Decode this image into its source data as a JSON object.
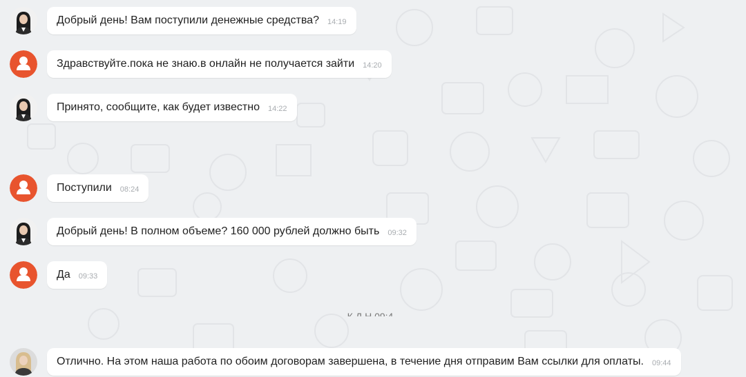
{
  "messages": [
    {
      "sender": "agent",
      "avatar_icon": "woman-photo-avatar-icon",
      "text": "Добрый день! Вам поступили денежные средства?",
      "time": "14:19"
    },
    {
      "sender": "client",
      "avatar_icon": "user-silhouette-avatar-icon",
      "text": "Здравствуйте.пока не знаю.в онлайн не получается зайти",
      "time": "14:20"
    },
    {
      "sender": "agent",
      "avatar_icon": "woman-photo-avatar-icon",
      "text": "Принято, сообщите, как будет известно",
      "time": "14:22"
    },
    {
      "sender": "client",
      "avatar_icon": "user-silhouette-avatar-icon",
      "text": "Поступили",
      "time": "08:24"
    },
    {
      "sender": "agent",
      "avatar_icon": "woman-photo-avatar-icon",
      "text": "Добрый день! В полном объеме? 160 000 рублей должно быть",
      "time": "09:32"
    },
    {
      "sender": "client",
      "avatar_icon": "user-silhouette-avatar-icon",
      "text": "Да",
      "time": "09:33"
    },
    {
      "sender": "agent2",
      "avatar_icon": "blonde-woman-photo-avatar-icon",
      "text": "Отлично. На этом наша работа по обоим договорам завершена, в течение дня отправим Вам ссылки для оплаты.",
      "time": "09:44"
    }
  ],
  "system_line": {
    "text": "К          Д      Н                09:4"
  },
  "colors": {
    "background": "#eef0f2",
    "bubble": "#ffffff",
    "client_avatar": "#e8542e",
    "time": "#a8acb0"
  }
}
